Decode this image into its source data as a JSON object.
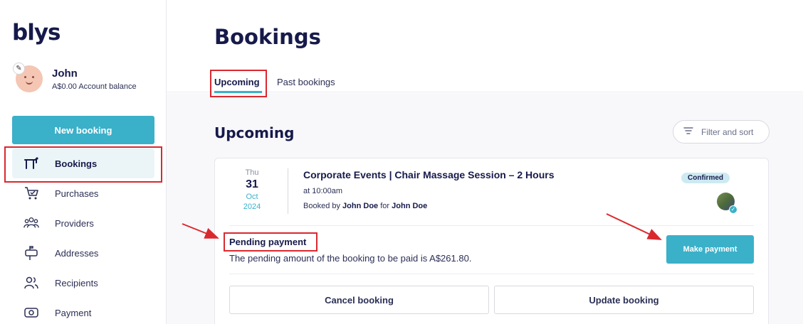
{
  "brand": {
    "logo": "blys",
    "accent": "#3bb0c9",
    "annotation": "#d9292f"
  },
  "profile": {
    "name": "John",
    "balance": "A$0.00 Account balance",
    "edit_icon": "pencil-icon"
  },
  "sidebar": {
    "new_booking_label": "New booking",
    "items": [
      {
        "label": "Bookings",
        "icon": "massage-table-icon",
        "active": true
      },
      {
        "label": "Purchases",
        "icon": "cart-icon"
      },
      {
        "label": "Providers",
        "icon": "people-group-icon"
      },
      {
        "label": "Addresses",
        "icon": "mailbox-icon"
      },
      {
        "label": "Recipients",
        "icon": "users-icon"
      },
      {
        "label": "Payment",
        "icon": "card-icon"
      }
    ]
  },
  "header": {
    "title": "Bookings",
    "tabs": [
      {
        "label": "Upcoming",
        "active": true
      },
      {
        "label": "Past bookings"
      }
    ]
  },
  "main": {
    "section_title": "Upcoming",
    "filter_label": "Filter and sort"
  },
  "booking": {
    "date": {
      "dow": "Thu",
      "day": "31",
      "month": "Oct",
      "year": "2024"
    },
    "title": "Corporate Events | Chair Massage Session – 2 Hours",
    "time": "at 10:00am",
    "booked_by_prefix": "Booked by",
    "booked_by": "John Doe",
    "for_prefix": "for",
    "recipient": "John Doe",
    "status": "Confirmed",
    "pending_title": "Pending payment",
    "pending_text": "The pending amount of the booking to be paid is A$261.80.",
    "make_payment_label": "Make payment",
    "cancel_label": "Cancel booking",
    "update_label": "Update booking"
  }
}
